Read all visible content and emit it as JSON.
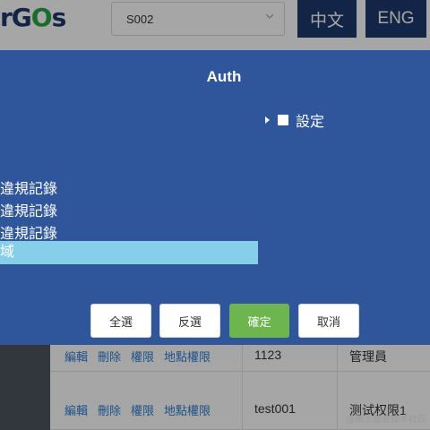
{
  "header": {
    "logo_main": "rG",
    "logo_accent": "O",
    "logo_tail": "s",
    "site_select_value": "S002",
    "lang_zh": "中文",
    "lang_en": "ENG"
  },
  "table": {
    "rows": [
      {
        "actions": [
          "編輯",
          "刪除",
          "權限",
          "地點權限"
        ],
        "user_id": "1123",
        "role": "管理員"
      },
      {
        "actions": [
          "編輯",
          "刪除",
          "權限",
          "地點權限"
        ],
        "user_id": "test001",
        "role": "测试权限1"
      }
    ]
  },
  "modal": {
    "title": "Auth",
    "tree_settings": "設定",
    "tree_items": [
      "違規記錄",
      "違規記錄",
      "違規記錄",
      "域"
    ],
    "buttons": {
      "select_all": "全選",
      "invert": "反選",
      "confirm": "確定",
      "cancel": "取消"
    }
  },
  "colors": {
    "modal_bg": "#2f569a",
    "selected_item": "#87ceeb",
    "confirm": "#6cb54f",
    "lang_btn": "#1e3a6e"
  },
  "watermark": "@稀土掘金技术社区"
}
